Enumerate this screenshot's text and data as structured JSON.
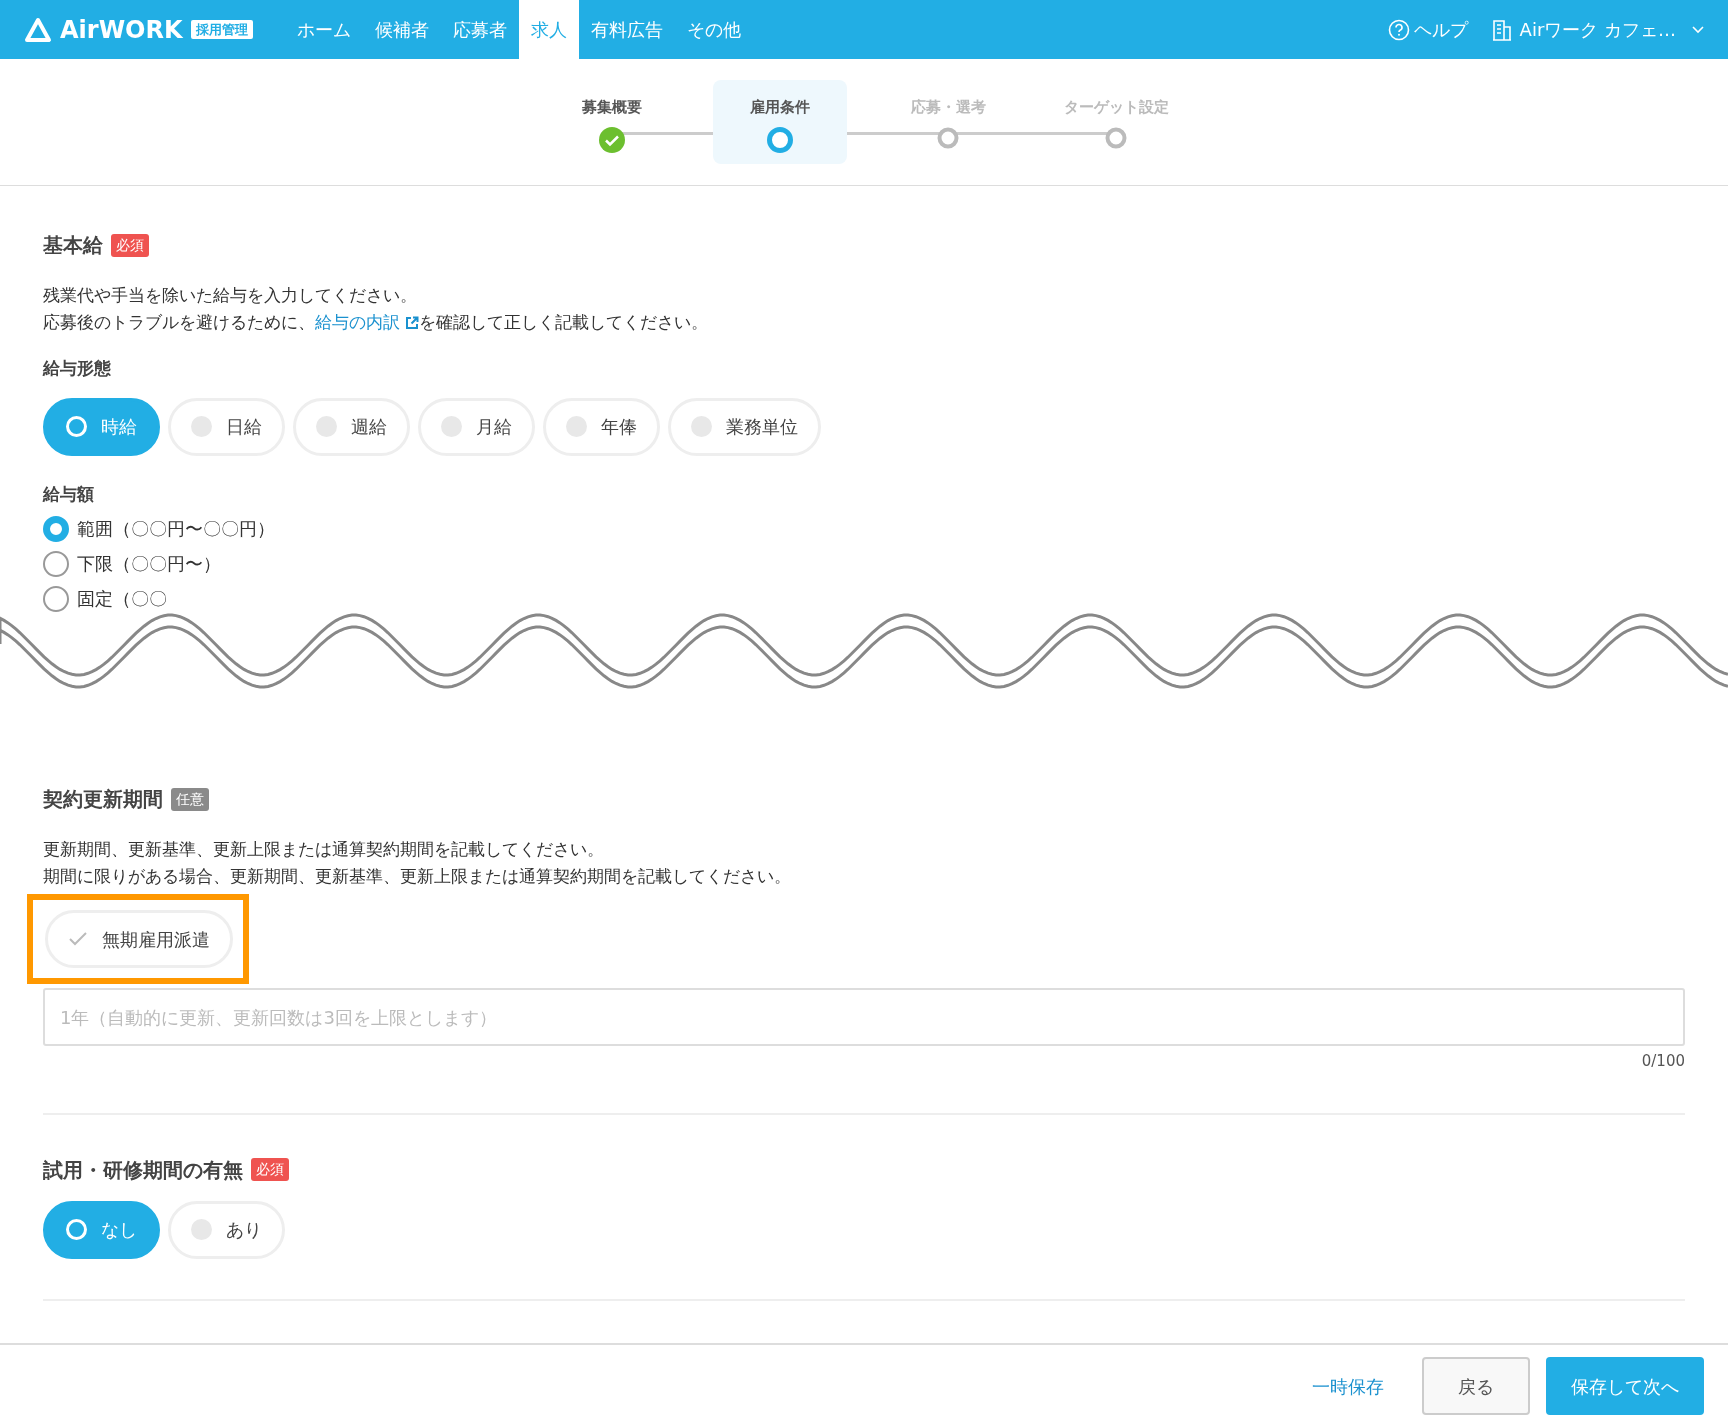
{
  "header": {
    "logo": "AirWORK",
    "logo_badge": "採用管理",
    "nav": [
      {
        "label": "ホーム",
        "selected": false
      },
      {
        "label": "候補者",
        "selected": false
      },
      {
        "label": "応募者",
        "selected": false
      },
      {
        "label": "求人",
        "selected": true
      },
      {
        "label": "有料広告",
        "selected": false
      },
      {
        "label": "その他",
        "selected": false
      }
    ],
    "help": "ヘルプ",
    "account": "Airワーク カフェ…"
  },
  "steps": [
    {
      "label": "募集概要",
      "completed": true,
      "selected": false
    },
    {
      "label": "雇用条件",
      "completed": false,
      "selected": true
    },
    {
      "label": "応募・選考",
      "completed": false,
      "selected": false
    },
    {
      "label": "ターゲット設定",
      "completed": false,
      "selected": false
    }
  ],
  "salary": {
    "title": "基本給",
    "badge": "必須",
    "required": true,
    "notes": [
      "残業代や手当を除いた給与を入力してください。",
      "応募後のトラブルを避けるために、",
      "給与の内訳",
      "を確認して正しく記載してください。"
    ],
    "type_label": "給与形態",
    "types": [
      {
        "label": "時給",
        "selected": true
      },
      {
        "label": "日給",
        "selected": false
      },
      {
        "label": "週給",
        "selected": false
      },
      {
        "label": "月給",
        "selected": false
      },
      {
        "label": "年俸",
        "selected": false
      },
      {
        "label": "業務単位",
        "selected": false
      }
    ],
    "amount_label": "給与額",
    "amounts": [
      {
        "label": "範囲（〇〇円〜〇〇円）",
        "selected": true
      },
      {
        "label": "下限（〇〇円〜）",
        "selected": false
      },
      {
        "label": "固定（〇〇",
        "selected": false
      }
    ]
  },
  "renewal": {
    "title": "契約更新期間",
    "badge": "任意",
    "required": false,
    "notes": [
      "更新期間、更新基準、更新上限または通算契約期間を記載してください。",
      "期間に限りがある場合、更新期間、更新基準、更新上限または通算契約期間を記載してください。"
    ],
    "checkbox": {
      "label": "無期雇用派遣",
      "checked": false,
      "highlighted": true
    },
    "placeholder": "1年（自動的に更新、更新回数は3回を上限とします）",
    "counter": "0/100"
  },
  "trial": {
    "title": "試用・研修期間の有無",
    "badge": "必須",
    "required": true,
    "options": [
      {
        "label": "なし",
        "selected": true
      },
      {
        "label": "あり",
        "selected": false
      }
    ]
  },
  "footer": {
    "temp_save": "一時保存",
    "back": "戻る",
    "next": "保存して次へ"
  }
}
